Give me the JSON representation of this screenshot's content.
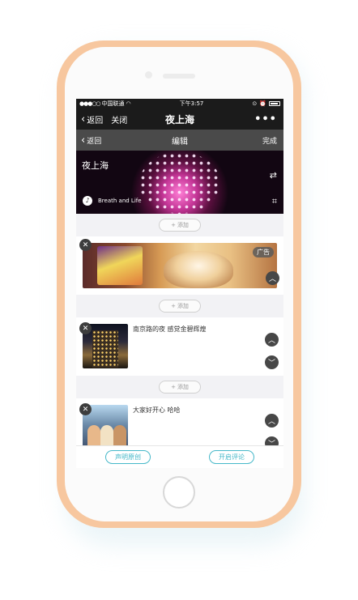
{
  "status_bar": {
    "carrier": "中国联通",
    "time": "下午3:57"
  },
  "nav": {
    "back_label": "返回",
    "close_label": "关闭",
    "title": "夜上海",
    "more_label": "•••"
  },
  "editor_bar": {
    "back_label": "返回",
    "title": "编辑",
    "done_label": "完成"
  },
  "cover": {
    "title": "夜上海",
    "music": "Breath and Life"
  },
  "add_button": {
    "label": "添加"
  },
  "ad": {
    "badge": "广告"
  },
  "posts": [
    {
      "text": "南京路的夜 感觉金碧辉煌"
    },
    {
      "text": "大家好开心 哈哈"
    }
  ],
  "footer": {
    "declare_original": "声明原创",
    "enable_comments": "开启评论"
  },
  "colors": {
    "accent": "#46b8c9",
    "frame": "#f7c79f",
    "nav_bg": "#1b1b1b",
    "toolbar_bg": "#4a4a4a"
  }
}
